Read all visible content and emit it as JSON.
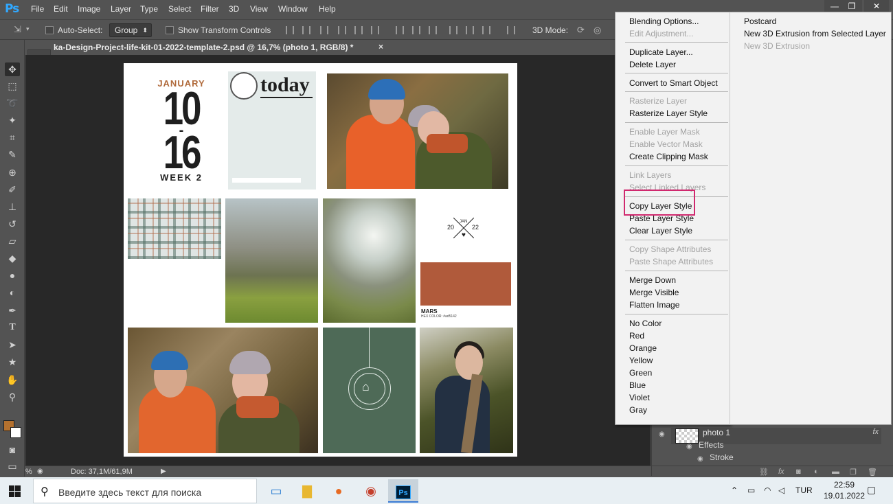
{
  "app": {
    "logo": "Ps",
    "menus": [
      "File",
      "Edit",
      "Image",
      "Layer",
      "Type",
      "Select",
      "Filter",
      "3D",
      "View",
      "Window",
      "Help"
    ],
    "window_buttons": {
      "minimize": "—",
      "restore": "❐",
      "close": "✕"
    }
  },
  "options_bar": {
    "auto_select_label": "Auto-Select:",
    "auto_select_value": "Group",
    "show_transform_label": "Show Transform Controls",
    "mode_3d_label": "3D Mode:"
  },
  "document": {
    "tab_title": "ka-Design-Project-life-kit-01-2022-template-2.psd @ 16,7% (photo 1, RGB/8) *",
    "close_glyph": "×",
    "month": "JANUARY",
    "day_start": "10",
    "day_end": "16",
    "week": "WEEK 2",
    "today": "today",
    "logo_jan": "JAN",
    "logo_year_a": "20",
    "logo_year_b": "22",
    "swatch_name": "MARS",
    "swatch_hex": "HEX COLOR: #ad5142",
    "swatch_color": "#b05a3b"
  },
  "context_menu": {
    "items": [
      {
        "label": "Blending Options...",
        "enabled": true
      },
      {
        "label": "Edit Adjustment...",
        "enabled": false
      },
      {
        "label": "Duplicate Layer...",
        "enabled": true
      },
      {
        "label": "Delete Layer",
        "enabled": true
      },
      {
        "label": "Convert to Smart Object",
        "enabled": true
      },
      {
        "label": "Rasterize Layer",
        "enabled": false
      },
      {
        "label": "Rasterize Layer Style",
        "enabled": true
      },
      {
        "label": "Enable Layer Mask",
        "enabled": false
      },
      {
        "label": "Enable Vector Mask",
        "enabled": false
      },
      {
        "label": "Create Clipping Mask",
        "enabled": true
      },
      {
        "label": "Link Layers",
        "enabled": false
      },
      {
        "label": "Select Linked Layers",
        "enabled": false
      },
      {
        "label": "Copy Layer Style",
        "enabled": true
      },
      {
        "label": "Paste Layer Style",
        "enabled": true
      },
      {
        "label": "Clear Layer Style",
        "enabled": true
      },
      {
        "label": "Copy Shape Attributes",
        "enabled": false
      },
      {
        "label": "Paste Shape Attributes",
        "enabled": false
      },
      {
        "label": "Merge Down",
        "enabled": true
      },
      {
        "label": "Merge Visible",
        "enabled": true
      },
      {
        "label": "Flatten Image",
        "enabled": true
      },
      {
        "label": "No Color",
        "enabled": true
      },
      {
        "label": "Red",
        "enabled": true
      },
      {
        "label": "Orange",
        "enabled": true
      },
      {
        "label": "Yellow",
        "enabled": true
      },
      {
        "label": "Green",
        "enabled": true
      },
      {
        "label": "Blue",
        "enabled": true
      },
      {
        "label": "Violet",
        "enabled": true
      },
      {
        "label": "Gray",
        "enabled": true
      }
    ],
    "submenu": [
      {
        "label": "Postcard",
        "enabled": true
      },
      {
        "label": "New 3D Extrusion from Selected Layer",
        "enabled": true
      },
      {
        "label": "New 3D Extrusion",
        "enabled": false
      }
    ],
    "highlighted_item": "Copy Layer Style",
    "highlight_color": "#d0286e"
  },
  "layers": {
    "layer_name": "photo 1",
    "fx_label": "fx",
    "effects_label": "Effects",
    "stroke_label": "Stroke"
  },
  "status": {
    "zoom": "%",
    "doc_size": "Doc: 37,1M/61,9M"
  },
  "taskbar": {
    "search_placeholder": "Введите здесь текст для поиска",
    "language": "TUR",
    "time": "22:59",
    "date": "19.01.2022",
    "ps_icon_label": "Ps"
  }
}
